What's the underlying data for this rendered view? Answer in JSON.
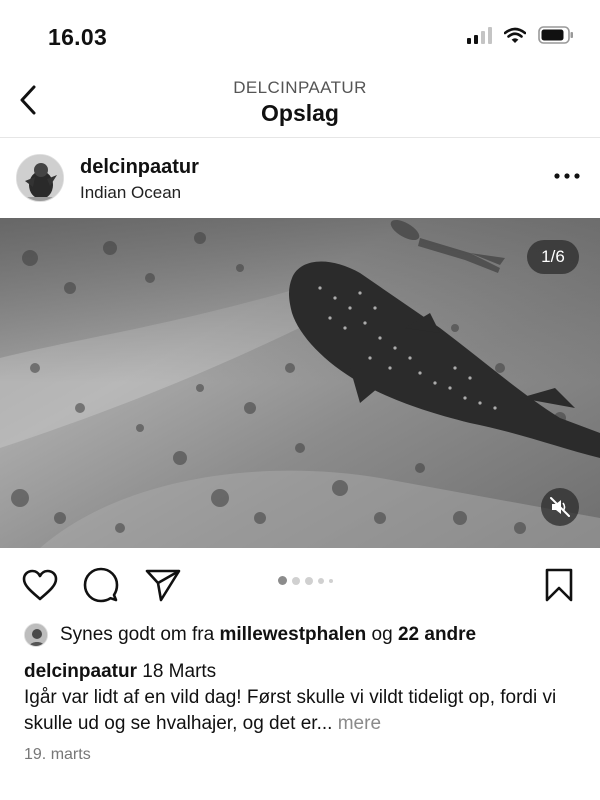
{
  "status_bar": {
    "time": "16.03",
    "icons": [
      "cellular-signal-icon",
      "wifi-icon",
      "battery-icon"
    ]
  },
  "header": {
    "subtitle": "DELCINPAATUR",
    "title": "Opslag",
    "back_icon": "chevron-left-icon"
  },
  "post": {
    "username": "delcinpaatur",
    "location": "Indian Ocean",
    "more_icon": "more-horizontal-icon",
    "media": {
      "counter": "1/6",
      "total_slides": 6,
      "current_slide": 1,
      "mute_icon": "speaker-muted-icon"
    },
    "actions": {
      "like_icon": "heart-icon",
      "comment_icon": "comment-icon",
      "share_icon": "send-icon",
      "save_icon": "bookmark-icon"
    },
    "likes": {
      "prefix": "Synes godt om fra",
      "user": "millewestphalen",
      "connector": "og",
      "others": "22 andre"
    },
    "caption": {
      "user": "delcinpaatur",
      "date_label": "18 Marts",
      "text": "Igår var lidt af en vild dag! Først skulle vi vildt tideligt op, fordi vi skulle ud og se hvalhajer, og det er...",
      "more_label": "mere"
    },
    "posted_date": "19. marts"
  },
  "colors": {
    "text": "#111111",
    "muted": "#777777",
    "divider": "#e6e6e6",
    "overlay": "#282828"
  }
}
